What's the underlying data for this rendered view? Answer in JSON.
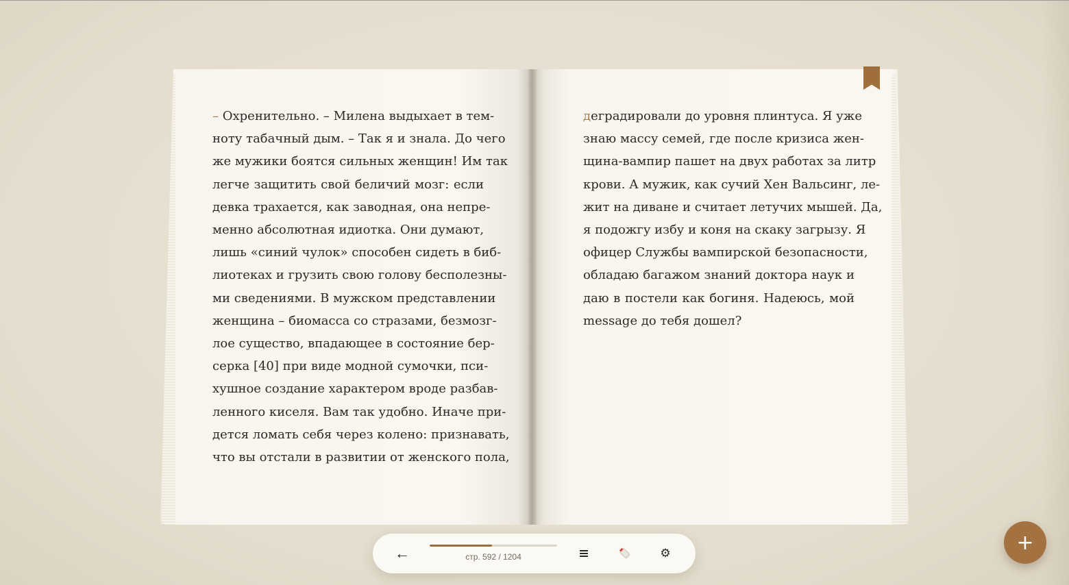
{
  "book": {
    "left_page": {
      "lines": [
        "Охренительно. – Милена выдыхает в тем-",
        "ноту табачный дым. – Так я и знала. До чего",
        "же мужики боятся сильных женщин! Им так",
        "легче защитить свой беличий мозг: если",
        "девка трахается, как заводная, она непре-",
        "менно абсолютная идиотка. Они думают,",
        "лишь «синий чулок» способен сидеть в биб-",
        "лиотеках и грузить свою голову бесполезны-",
        "ми сведениями. В мужском представлении",
        "женщина – биомасса со стразами, безмозг-",
        "лое существо, впадающее в состояние бер-",
        "серка [40] при виде модной сумочки, пси-",
        "хушное создание характером вроде разбав-",
        "ленного киселя. Вам так удобно. Иначе при-",
        "дется ломать себя через колено: признавать,",
        "что вы отстали в развитии от женского пола,"
      ],
      "first_mark": "–"
    },
    "right_page": {
      "first_letter": "д",
      "lines": [
        "еградировали до уровня плинтуса. Я уже",
        "знаю массу семей, где после кризиса жен-",
        "щина-вампир пашет на двух работах за литр",
        "крови. А мужик, как сучий Хен Вальсинг, ле-",
        "жит на диване и считает летучих мышей. Да,",
        "я подожгу избу и коня на скаку загрызу. Я",
        "офицер Службы вампирской безопасности,",
        "обладаю багажом знаний доктора наук и",
        "даю в постели как богиня. Надеюсь, мой",
        "message до тебя дошел?"
      ]
    },
    "bookmark_icon": "bookmark-icon"
  },
  "toolbar": {
    "back_icon": "←",
    "page_label": "стр. 592 / 1204",
    "current_page": 592,
    "total_pages": 1204,
    "menu_icon": "menu-icon",
    "marker_icon": "marker-icon",
    "settings_icon": "⚙"
  },
  "fab": {
    "label": "+"
  },
  "colors": {
    "accent": "#a47140",
    "page": "#f9f6ef",
    "background": "#e6e0d2",
    "text": "#2c2a26"
  }
}
